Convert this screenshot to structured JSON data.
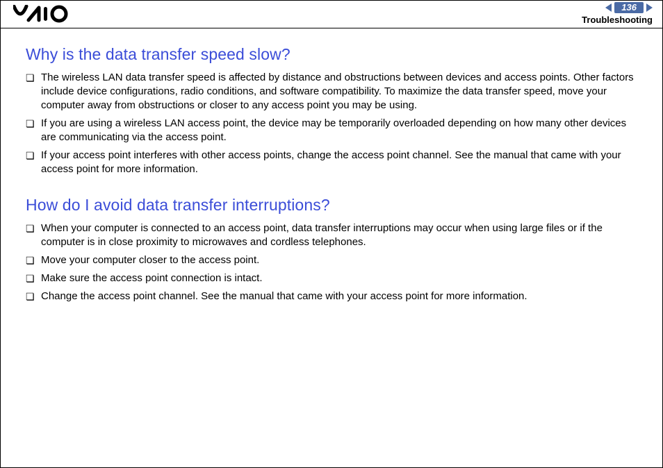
{
  "header": {
    "page_number": "136",
    "section": "Troubleshooting"
  },
  "content": {
    "sections": [
      {
        "heading": "Why is the data transfer speed slow?",
        "items": [
          "The wireless LAN data transfer speed is affected by distance and obstructions between devices and access points. Other factors include device configurations, radio conditions, and software compatibility. To maximize the data transfer speed, move your computer away from obstructions or closer to any access point you may be using.",
          "If you are using a wireless LAN access point, the device may be temporarily overloaded depending on how many other devices are communicating via the access point.",
          "If your access point interferes with other access points, change the access point channel. See the manual that came with your access point for more information."
        ]
      },
      {
        "heading": "How do I avoid data transfer interruptions?",
        "items": [
          "When your computer is connected to an access point, data transfer interruptions may occur when using large files or if the computer is in close proximity to microwaves and cordless telephones.",
          "Move your computer closer to the access point.",
          "Make sure the access point connection is intact.",
          "Change the access point channel. See the manual that came with your access point for more information."
        ]
      }
    ]
  }
}
